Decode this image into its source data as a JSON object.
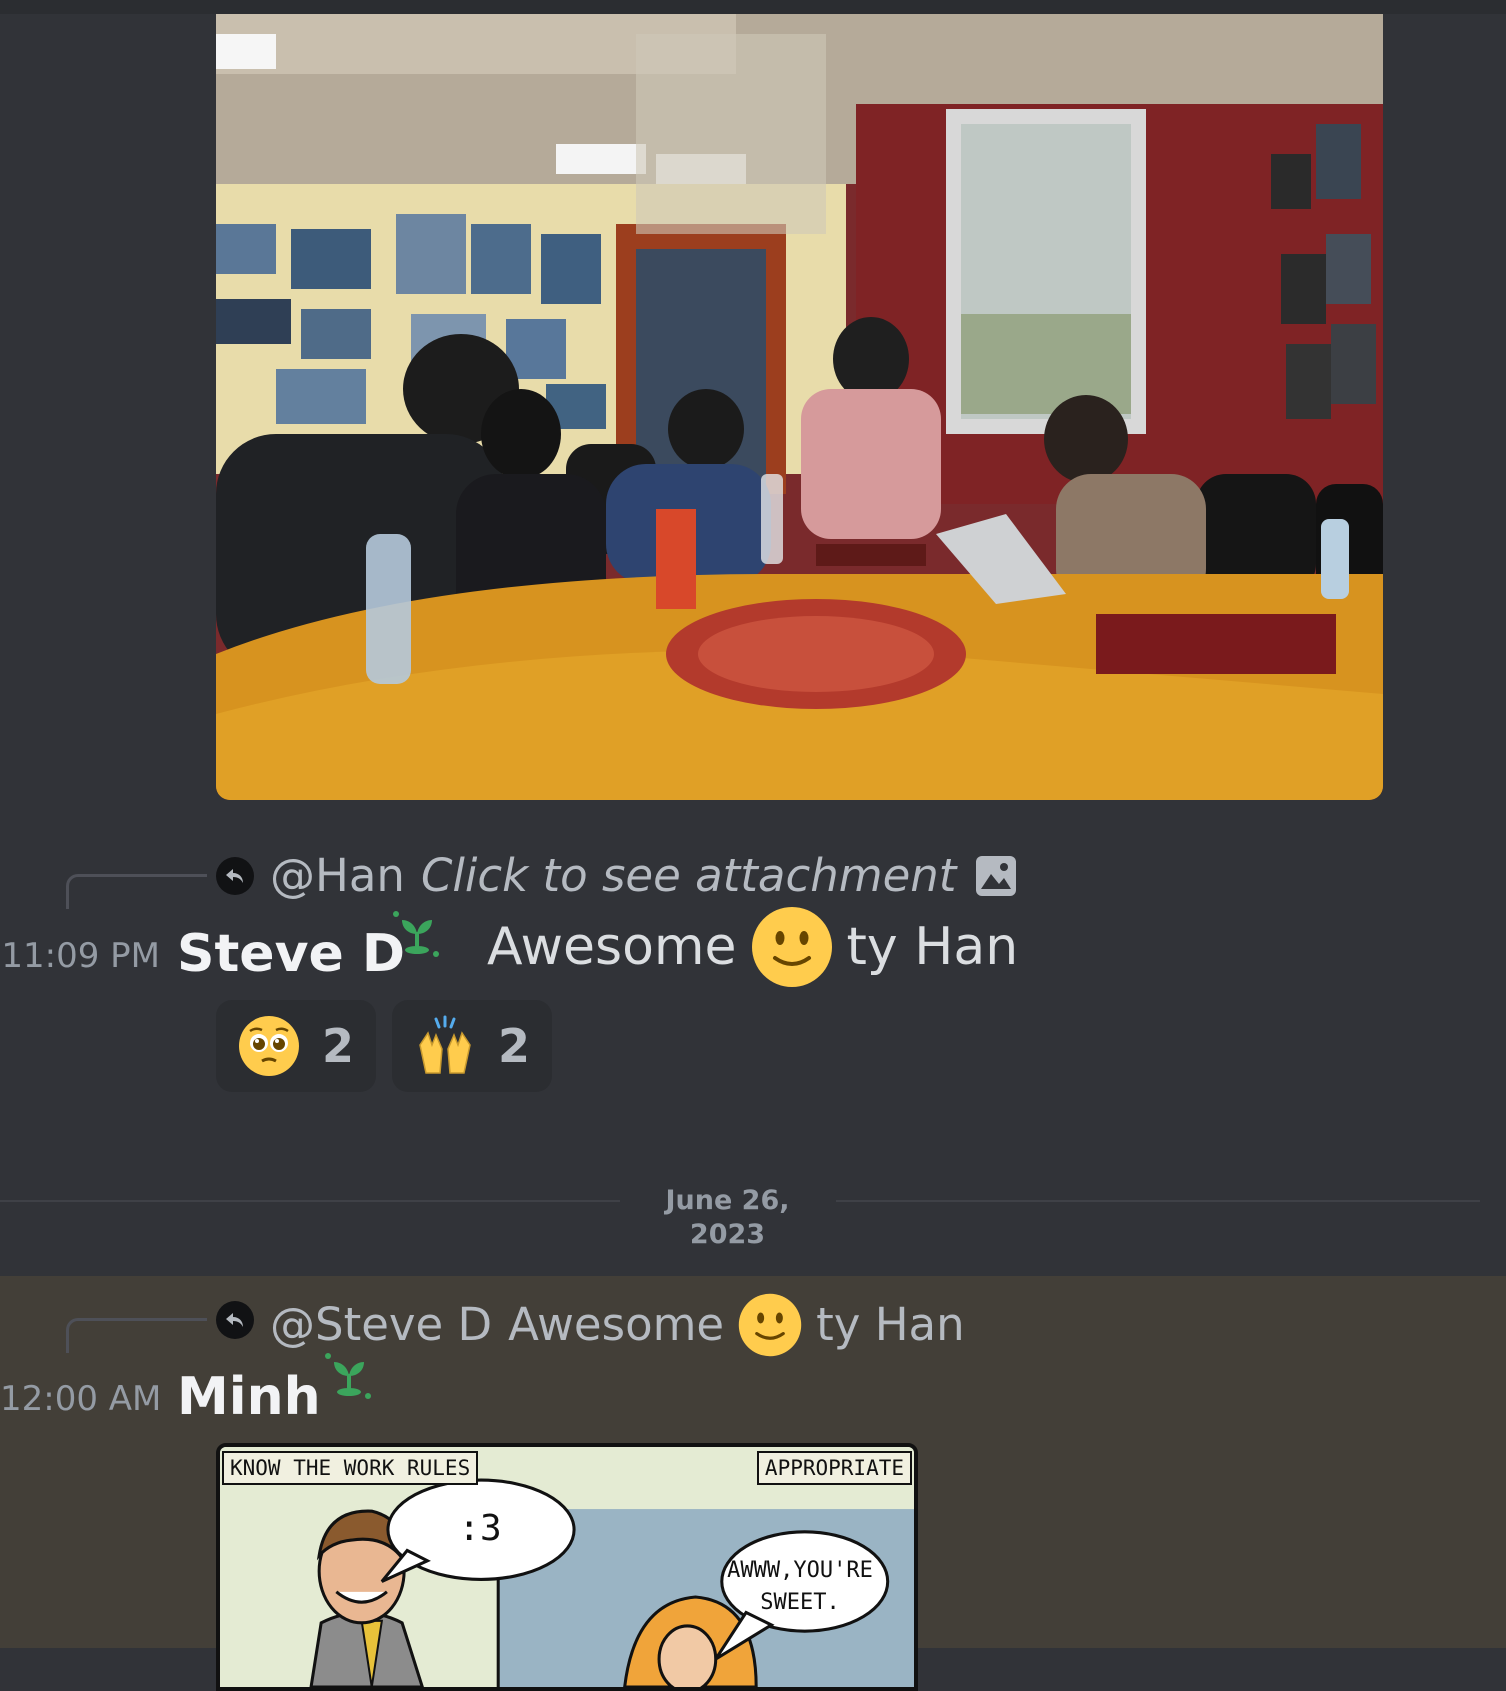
{
  "message1": {
    "reply": {
      "mention": "@Han",
      "text": "Click to see attachment",
      "icon": "image-icon"
    },
    "timestamp": "11:09 PM",
    "author": "Steve D",
    "content_before": "Awesome",
    "content_after": "ty Han",
    "reactions": [
      {
        "emoji": "pleading-face",
        "count": "2"
      },
      {
        "emoji": "raising-hands",
        "count": "2"
      }
    ]
  },
  "divider": {
    "date": "June 26, 2023"
  },
  "message2": {
    "reply": {
      "mention": "@Steve D",
      "text_before": "Awesome",
      "text_after": "ty Han"
    },
    "timestamp": "12:00 AM",
    "author": "Minh",
    "comic": {
      "label_left": "KNOW THE WORK RULES",
      "label_right": "APPROPRIATE",
      "bubble1": ":3",
      "bubble2_line1": "AWWW,YOU'RE",
      "bubble2_line2": "SWEET."
    }
  },
  "colors": {
    "background": "#313338",
    "highlight": "#433f38",
    "reaction_bg": "#2b2d31",
    "muted_text": "#949ba4",
    "author_text": "#f2f3f5"
  }
}
